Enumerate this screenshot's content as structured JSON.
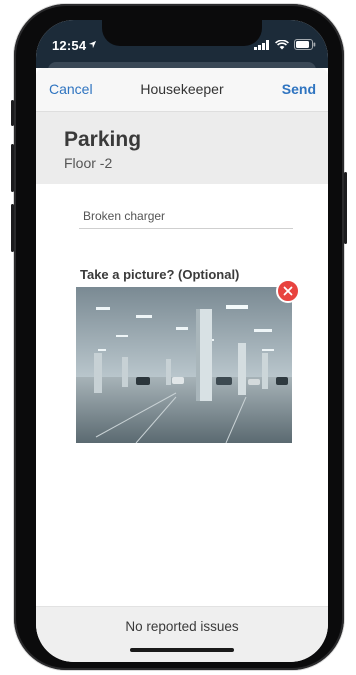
{
  "status": {
    "time": "12:54"
  },
  "nav": {
    "cancel_label": "Cancel",
    "title": "Housekeeper",
    "send_label": "Send"
  },
  "location": {
    "title": "Parking",
    "subtitle": "Floor -2"
  },
  "issue": {
    "value": "Broken charger"
  },
  "photo": {
    "label": "Take a picture? (Optional)"
  },
  "footer": {
    "text": "No reported issues"
  },
  "colors": {
    "accent": "#2f74c0",
    "remove": "#e8433f",
    "statusbar": "#1c2b39"
  },
  "icons": [
    "location-arrow-icon",
    "signal-icon",
    "wifi-icon",
    "battery-icon",
    "close-icon"
  ]
}
